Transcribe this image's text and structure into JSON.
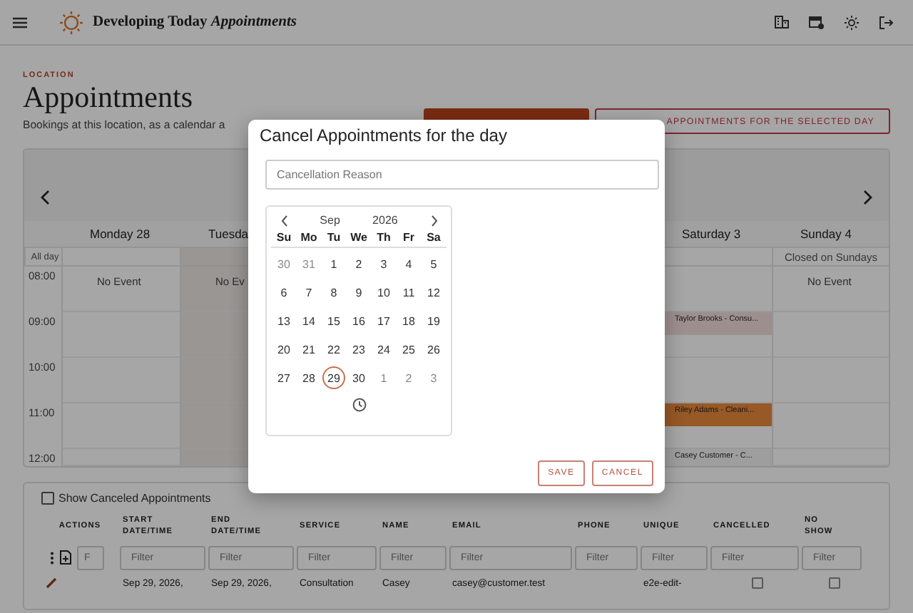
{
  "header": {
    "title": "Developing Today *Appointments*"
  },
  "page": {
    "eyebrow": "LOCATION",
    "title": "Appointments",
    "subtitle": "Bookings at this location, as a calendar a"
  },
  "actions": [
    {
      "kind": "filled"
    },
    {
      "kind": "outline",
      "label": "APPOINTMENTS FOR THE SELECTED DAY"
    }
  ],
  "calendar": {
    "all_day_label": "All day",
    "days": [
      {
        "heading": "Monday 28",
        "selected": false
      },
      {
        "heading": "Tuesda",
        "selected": true
      },
      {
        "heading": "Saturday 3",
        "selected": false
      },
      {
        "heading": "Sunday 4",
        "selected": false,
        "all_day": "Closed on Sundays"
      }
    ],
    "rows": [
      {
        "time": "08:00",
        "cells": [
          {
            "kind": "note",
            "text": "No Event"
          },
          {
            "kind": "note",
            "text": "No Ev"
          },
          {
            "kind": "blank"
          },
          {
            "kind": "note",
            "text": "No Event"
          }
        ]
      },
      {
        "time": "09:00",
        "cells": [
          {
            "kind": "blank"
          },
          {
            "kind": "blank"
          },
          {
            "kind": "event",
            "text": "Taylor Brooks - Consu...",
            "color": "#9e8f8f"
          },
          {
            "kind": "blank"
          }
        ]
      },
      {
        "time": "10:00",
        "cells": [
          {
            "kind": "blank"
          },
          {
            "kind": "blank"
          },
          {
            "kind": "blank"
          },
          {
            "kind": "blank"
          }
        ]
      },
      {
        "time": "11:00",
        "cells": [
          {
            "kind": "blank"
          },
          {
            "kind": "blank"
          },
          {
            "kind": "event",
            "text": "Riley Adams - Cleani...",
            "color": "#975926"
          },
          {
            "kind": "blank"
          }
        ]
      },
      {
        "time": "12:00",
        "cells": [
          {
            "kind": "blank"
          },
          {
            "kind": "blank"
          },
          {
            "kind": "event",
            "text": "Casey Customer - C...",
            "color": "#9e9e9e"
          },
          {
            "kind": "blank"
          }
        ]
      }
    ]
  },
  "dialog": {
    "title": "Cancel Appointments for the day",
    "reason": {
      "placeholder": "Cancellation Reason"
    },
    "date_picker": {
      "month": "Sep",
      "year": "2026",
      "weekdays": [
        "Su",
        "Mo",
        "Tu",
        "We",
        "Th",
        "Fr",
        "Sa"
      ],
      "weeks": [
        [
          {
            "day": "30",
            "muted": true,
            "selected": false
          },
          {
            "day": "31",
            "muted": true,
            "selected": false
          },
          {
            "day": "1",
            "muted": false,
            "selected": false
          },
          {
            "day": "2",
            "muted": false,
            "selected": false
          },
          {
            "day": "3",
            "muted": false,
            "selected": false
          },
          {
            "day": "4",
            "muted": false,
            "selected": false
          },
          {
            "day": "5",
            "muted": false,
            "selected": false
          }
        ],
        [
          {
            "day": "6",
            "muted": false,
            "selected": false
          },
          {
            "day": "7",
            "muted": false,
            "selected": false
          },
          {
            "day": "8",
            "muted": false,
            "selected": false
          },
          {
            "day": "9",
            "muted": false,
            "selected": false
          },
          {
            "day": "10",
            "muted": false,
            "selected": false
          },
          {
            "day": "11",
            "muted": false,
            "selected": false
          },
          {
            "day": "12",
            "muted": false,
            "selected": false
          }
        ],
        [
          {
            "day": "13",
            "muted": false,
            "selected": false
          },
          {
            "day": "14",
            "muted": false,
            "selected": false
          },
          {
            "day": "15",
            "muted": false,
            "selected": false
          },
          {
            "day": "16",
            "muted": false,
            "selected": false
          },
          {
            "day": "17",
            "muted": false,
            "selected": false
          },
          {
            "day": "18",
            "muted": false,
            "selected": false
          },
          {
            "day": "19",
            "muted": false,
            "selected": false
          }
        ],
        [
          {
            "day": "20",
            "muted": false,
            "selected": false
          },
          {
            "day": "21",
            "muted": false,
            "selected": false
          },
          {
            "day": "22",
            "muted": false,
            "selected": false
          },
          {
            "day": "23",
            "muted": false,
            "selected": false
          },
          {
            "day": "24",
            "muted": false,
            "selected": false
          },
          {
            "day": "25",
            "muted": false,
            "selected": false
          },
          {
            "day": "26",
            "muted": false,
            "selected": false
          }
        ],
        [
          {
            "day": "27",
            "muted": false,
            "selected": false
          },
          {
            "day": "28",
            "muted": false,
            "selected": false
          },
          {
            "day": "29",
            "muted": false,
            "selected": true
          },
          {
            "day": "30",
            "muted": false,
            "selected": false
          },
          {
            "day": "1",
            "muted": true,
            "selected": false
          },
          {
            "day": "2",
            "muted": true,
            "selected": false
          },
          {
            "day": "3",
            "muted": true,
            "selected": false
          }
        ]
      ]
    },
    "buttons": [
      "SAVE",
      "CANCEL"
    ]
  },
  "table": {
    "show_canceled": {
      "label": "Show Canceled Appointments",
      "checked": false
    },
    "columns": [
      "ACTIONS",
      "START DATE/TIME",
      "END DATE/TIME",
      "SERVICE",
      "NAME",
      "EMAIL",
      "PHONE",
      "UNIQUE",
      "CANCELLED",
      "NO SHOW"
    ],
    "filter_row": {
      "first": {
        "placeholder": "F"
      },
      "fields": [
        {
          "placeholder": "Filter"
        },
        {
          "placeholder": "Filter"
        },
        {
          "placeholder": "Filter"
        },
        {
          "placeholder": "Filter"
        },
        {
          "placeholder": "Filter"
        },
        {
          "placeholder": "Filter"
        },
        {
          "placeholder": "Filter"
        },
        {
          "placeholder": "Filter"
        },
        {
          "placeholder": "Filter"
        }
      ]
    },
    "rows": [
      {
        "start": "Sep 29, 2026,",
        "end": "Sep 29, 2026,",
        "service": "Consultation",
        "name": "Casey",
        "email": "casey@customer.test",
        "unique": "e2e-edit-",
        "cancelled": false,
        "no_show": false
      }
    ]
  }
}
